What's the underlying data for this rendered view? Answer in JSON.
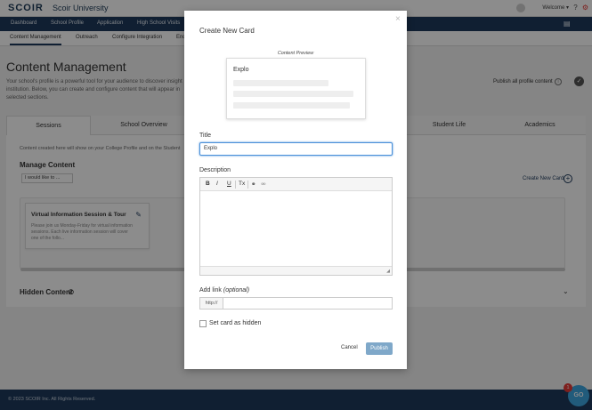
{
  "topbar": {
    "logo": "SCOIR",
    "app_name": "Scoir University",
    "welcome": "Welcome ▾"
  },
  "main_nav": [
    "Dashboard",
    "School Profile",
    "Application",
    "High School Visits"
  ],
  "sub_nav": [
    "Content Management",
    "Outreach",
    "Configure Integration",
    "End"
  ],
  "page": {
    "title": "Content Management",
    "description": "Your school's profile is a powerful tool for your audience to discover insight institution. Below, you can create and configure content that will appear in selected sections.",
    "publish_all": "Publish all profile content"
  },
  "tabs": [
    "Sessions",
    "School Overview",
    "Student Life",
    "Academics"
  ],
  "content": {
    "intro": "Content created here will show on your College Profile and on the Student",
    "manage_title": "Manage Content",
    "select_value": "I would like to ...",
    "create_new": "Create New Card",
    "card": {
      "title": "Virtual Information Session & Tour",
      "body": "Please join us Monday-Friday for virtual information sessions. Each live information session will cover one of the follo..."
    },
    "hidden_content": "Hidden Content"
  },
  "footer": {
    "copyright": "© 2023 SCOIR Inc. All Rights Reserved."
  },
  "help": {
    "badge": "1",
    "label": "GO"
  },
  "modal": {
    "title": "Create New Card",
    "close": "×",
    "preview_label": "Content Preview",
    "preview_name": "Explo",
    "title_label": "Title",
    "title_value": "Explo",
    "description_label": "Description",
    "toolbar": [
      "B",
      "I",
      "U",
      "Tx"
    ],
    "add_link_label": "Add link",
    "add_link_optional": "(optional)",
    "link_prefix": "http://",
    "hidden_label": "Set card as hidden",
    "cancel": "Cancel",
    "publish": "Publish"
  }
}
